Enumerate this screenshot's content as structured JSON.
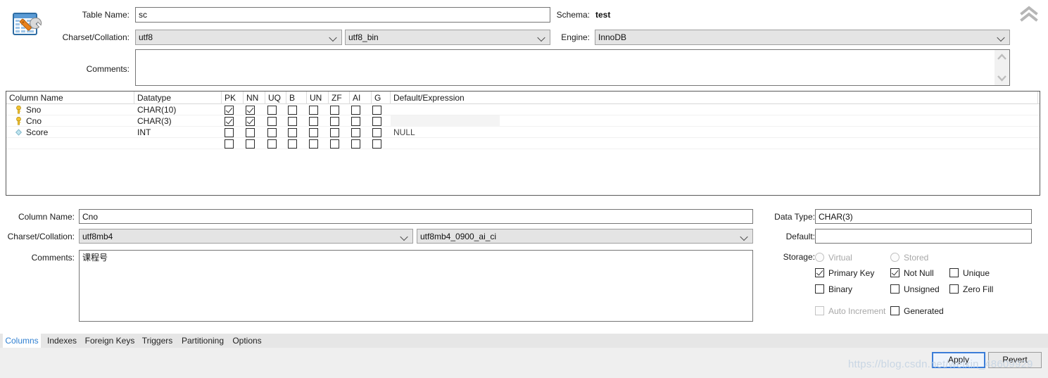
{
  "window": {
    "icon_name": "table-editor-icon",
    "collapse_button": "collapse-panel-icon"
  },
  "header": {
    "table_name_label": "Table Name:",
    "table_name_value": "sc",
    "schema_label": "Schema:",
    "schema_value": "test",
    "charset_label": "Charset/Collation:",
    "charset_value": "utf8",
    "collation_value": "utf8_bin",
    "engine_label": "Engine:",
    "engine_value": "InnoDB",
    "comments_label": "Comments:",
    "comments_value": ""
  },
  "grid": {
    "headers": [
      "Column Name",
      "Datatype",
      "PK",
      "NN",
      "UQ",
      "B",
      "UN",
      "ZF",
      "AI",
      "G",
      "Default/Expression"
    ],
    "rows": [
      {
        "icon": "primary-key-icon",
        "name": "Sno",
        "datatype": "CHAR(10)",
        "flags": [
          true,
          true,
          false,
          false,
          false,
          false,
          false,
          false
        ],
        "default": "",
        "selected": false
      },
      {
        "icon": "primary-key-icon",
        "name": "Cno",
        "datatype": "CHAR(3)",
        "flags": [
          true,
          true,
          false,
          false,
          false,
          false,
          false,
          false
        ],
        "default": "",
        "selected": true
      },
      {
        "icon": "column-icon",
        "name": "Score",
        "datatype": "INT",
        "flags": [
          false,
          false,
          false,
          false,
          false,
          false,
          false,
          false
        ],
        "default": "NULL",
        "selected": false
      },
      {
        "icon": "",
        "name": "",
        "datatype": "",
        "flags": [
          false,
          false,
          false,
          false,
          false,
          false,
          false,
          false
        ],
        "default": "",
        "selected": false
      }
    ]
  },
  "detail": {
    "column_name_label": "Column Name:",
    "column_name_value": "Cno",
    "charset_label": "Charset/Collation:",
    "charset_value": "utf8mb4",
    "collation_value": "utf8mb4_0900_ai_ci",
    "comments_label": "Comments:",
    "comments_value": "课程号",
    "data_type_label": "Data Type:",
    "data_type_value": "CHAR(3)",
    "default_label": "Default:",
    "default_value": "",
    "storage_label": "Storage:",
    "options": [
      {
        "name": "virtual",
        "label": "Virtual",
        "type": "radio",
        "checked": false,
        "disabled": true
      },
      {
        "name": "stored",
        "label": "Stored",
        "type": "radio",
        "checked": false,
        "disabled": true
      },
      {
        "name": "primary-key",
        "label": "Primary Key",
        "type": "checkbox",
        "checked": true,
        "disabled": false
      },
      {
        "name": "not-null",
        "label": "Not Null",
        "type": "checkbox",
        "checked": true,
        "disabled": false
      },
      {
        "name": "unique",
        "label": "Unique",
        "type": "checkbox",
        "checked": false,
        "disabled": false
      },
      {
        "name": "binary",
        "label": "Binary",
        "type": "checkbox",
        "checked": false,
        "disabled": false
      },
      {
        "name": "unsigned",
        "label": "Unsigned",
        "type": "checkbox",
        "checked": false,
        "disabled": false
      },
      {
        "name": "zero-fill",
        "label": "Zero Fill",
        "type": "checkbox",
        "checked": false,
        "disabled": false
      },
      {
        "name": "auto-increment",
        "label": "Auto Increment",
        "type": "checkbox",
        "checked": false,
        "disabled": true
      },
      {
        "name": "generated",
        "label": "Generated",
        "type": "checkbox",
        "checked": false,
        "disabled": false
      }
    ]
  },
  "tabs": [
    {
      "label": "Columns",
      "active": true
    },
    {
      "label": "Indexes",
      "active": false
    },
    {
      "label": "Foreign Keys",
      "active": false
    },
    {
      "label": "Triggers",
      "active": false
    },
    {
      "label": "Partitioning",
      "active": false
    },
    {
      "label": "Options",
      "active": false
    }
  ],
  "footer": {
    "apply_label": "Apply",
    "revert_label": "Revert"
  },
  "watermark": "https://blog.csdn.net/weixin_48609929",
  "colors": {
    "accent": "#2f7fd1",
    "primary_button_border": "#3b7dd8",
    "key_icon": "#f2c231",
    "column_icon": "#bfe4ef",
    "combo_bg": "#e4e4e4",
    "tabbar_bg": "#e6e6e6",
    "grid_border": "#585858"
  }
}
